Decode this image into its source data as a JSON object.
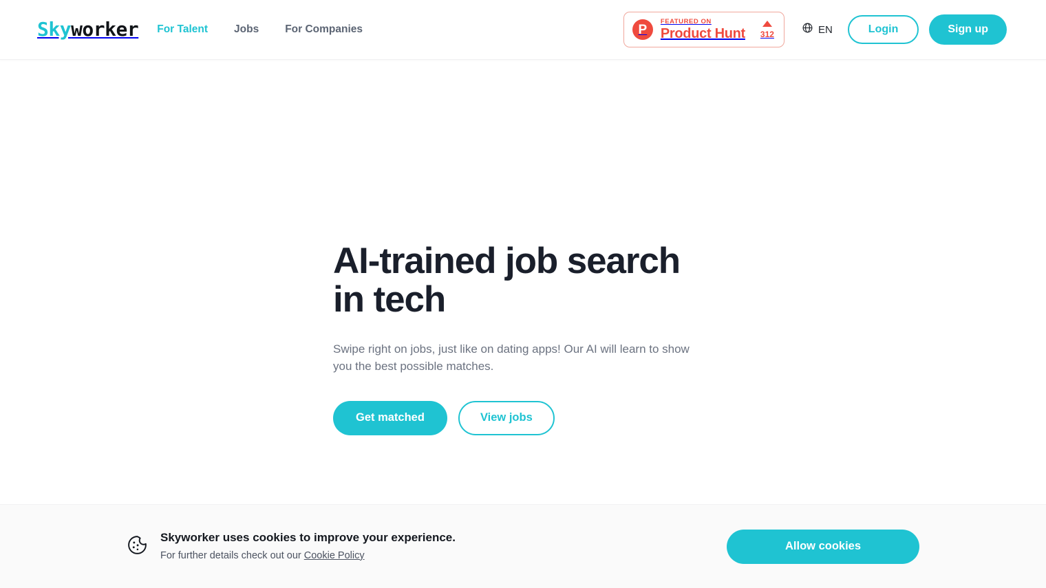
{
  "brand": {
    "logo_part1": "Sky",
    "logo_part2": "worker",
    "accent_color": "#1FC3D2",
    "dark_color": "#1a1f2b",
    "producthunt_color": "#ef4a3e"
  },
  "header": {
    "nav": [
      {
        "label": "For Talent",
        "active": true
      },
      {
        "label": "Jobs",
        "active": false
      },
      {
        "label": "For Companies",
        "active": false
      }
    ],
    "product_hunt": {
      "logo_letter": "P",
      "featured_label": "FEATURED ON",
      "name": "Product Hunt",
      "upvote_icon": "triangle-up-icon",
      "upvote_count": "312"
    },
    "language": {
      "icon": "globe-icon",
      "label": "EN"
    },
    "login_label": "Login",
    "signup_label": "Sign up"
  },
  "hero": {
    "title": "AI-trained job search\nin tech",
    "subtitle": "Swipe right on jobs, just like on dating apps! Our AI will learn to show you the best possible matches.",
    "primary_cta": "Get matched",
    "secondary_cta": "View jobs"
  },
  "cookie_banner": {
    "icon": "cookie-icon",
    "title": "Skyworker uses cookies to improve your experience.",
    "subtitle_prefix": "For further details check out our ",
    "policy_link": "Cookie Policy",
    "allow_label": "Allow cookies"
  }
}
